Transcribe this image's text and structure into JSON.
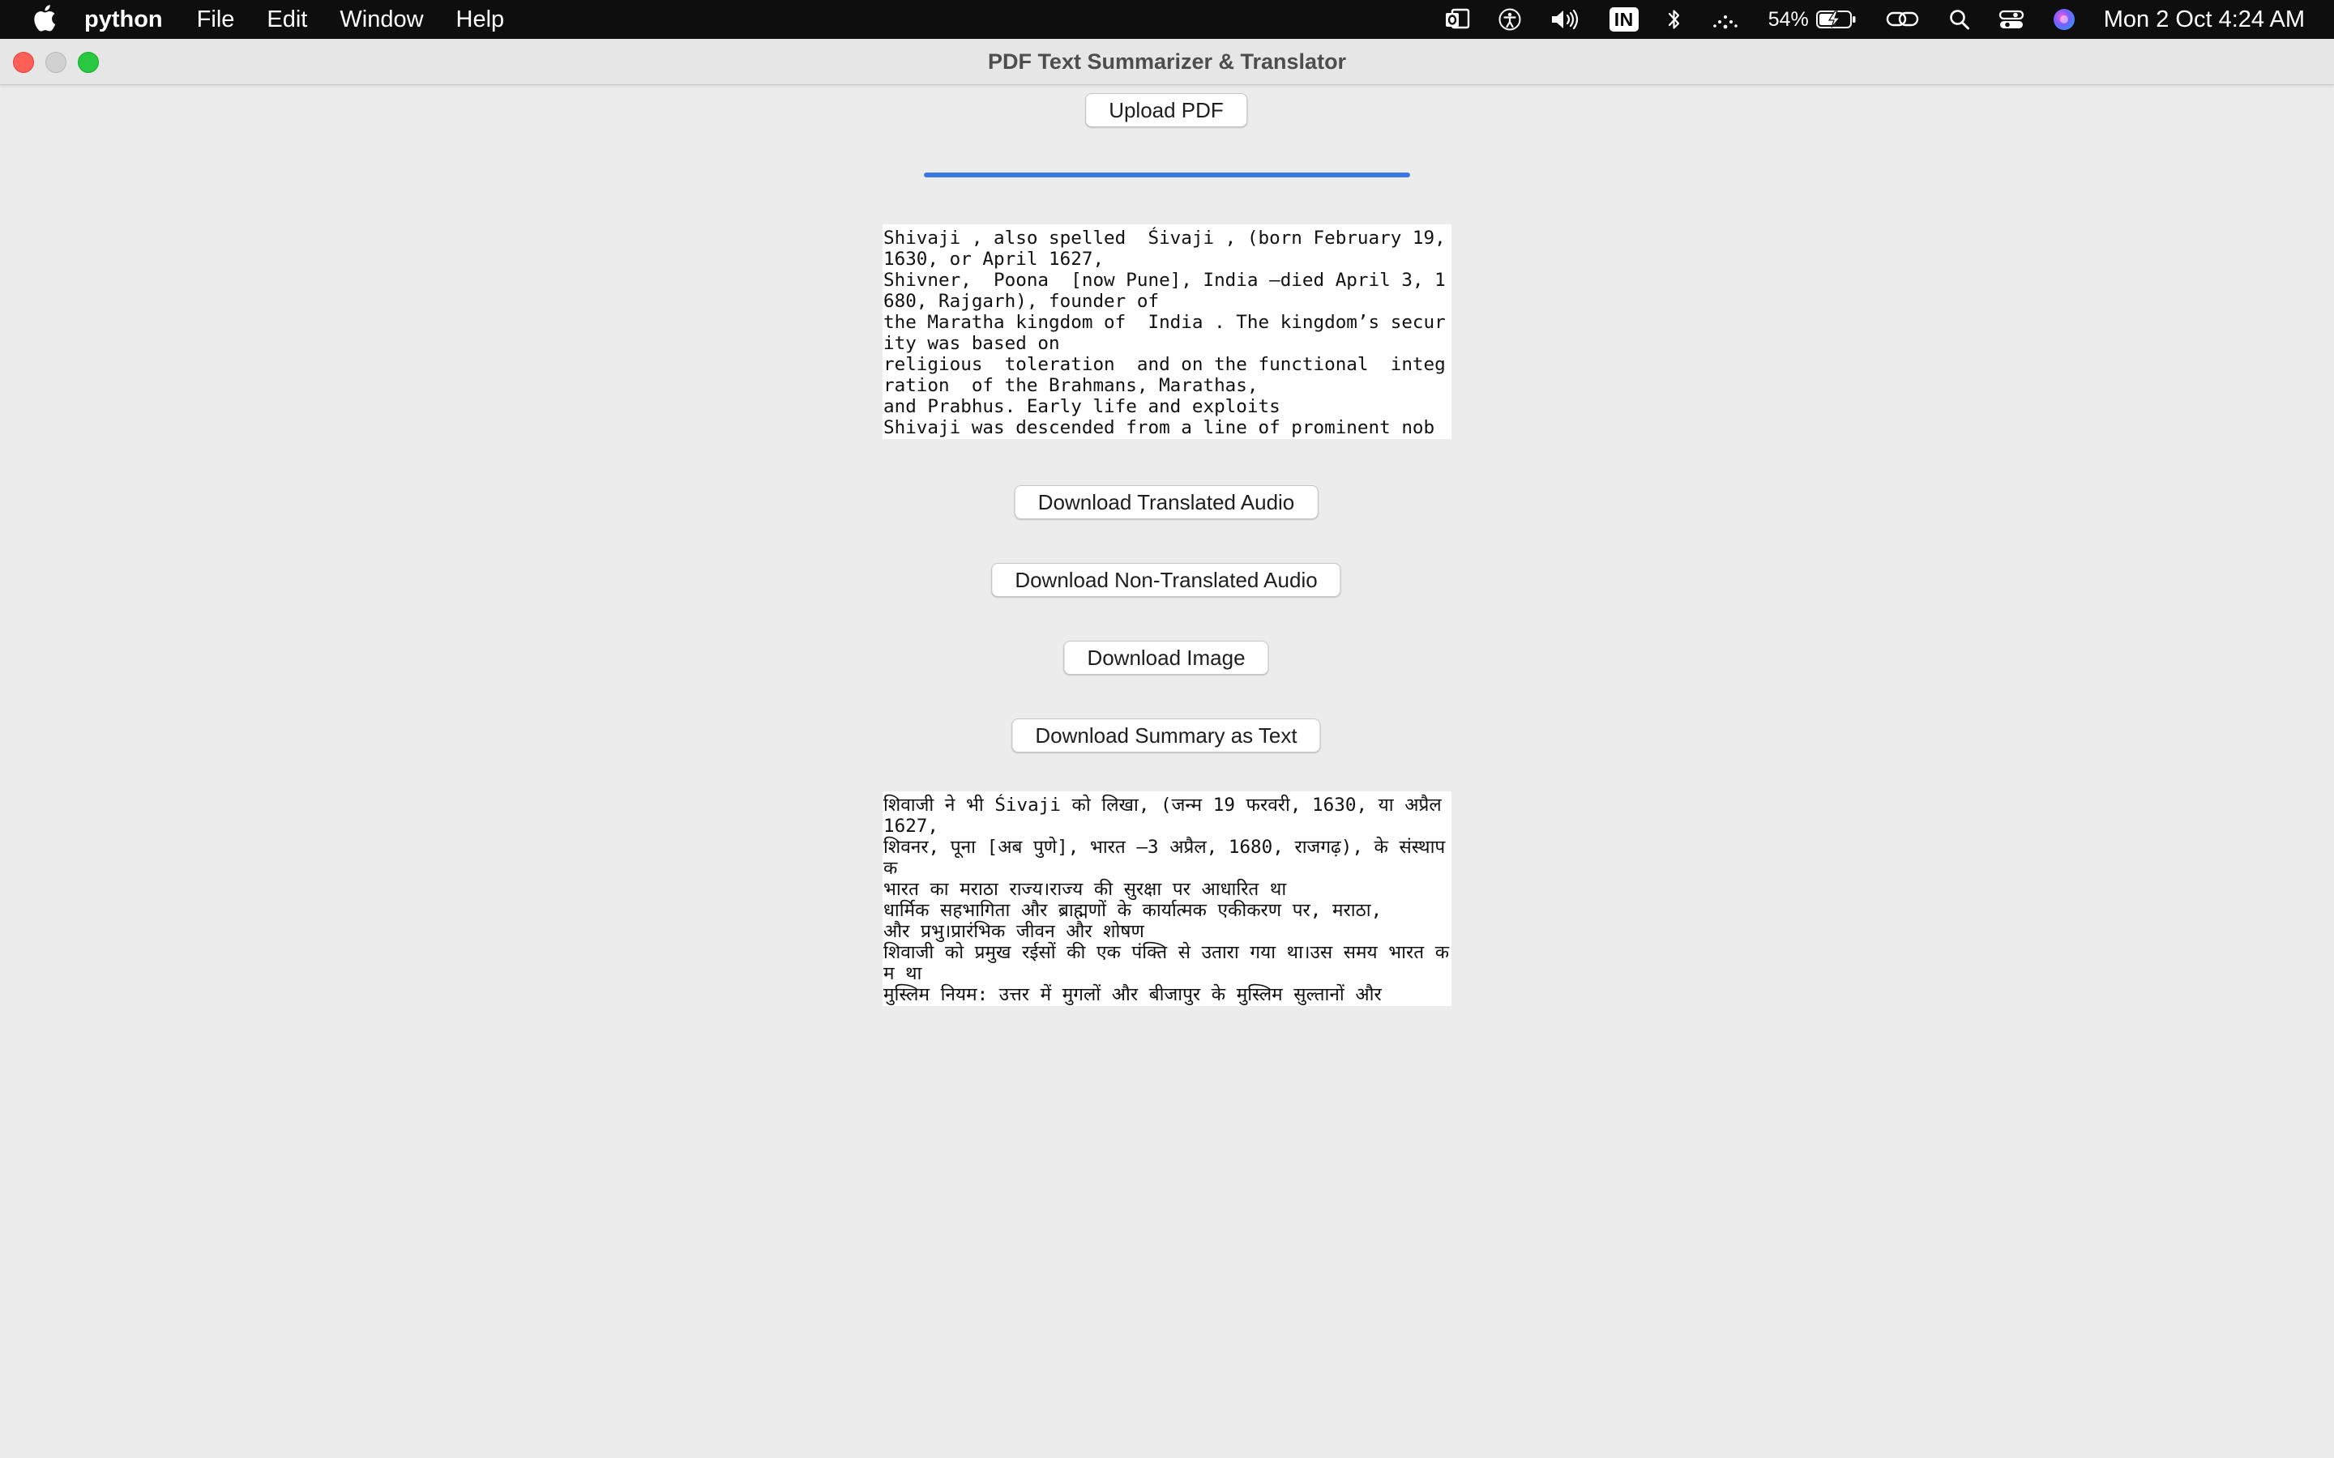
{
  "menubar": {
    "apple_icon": "apple-logo-icon",
    "app_name": "python",
    "menus": [
      "File",
      "Edit",
      "Window",
      "Help"
    ],
    "status": {
      "input_source": "IN",
      "battery_percent": "54%",
      "datetime": "Mon 2 Oct  4:24 AM"
    }
  },
  "window": {
    "title": "PDF Text Summarizer & Translator"
  },
  "upload_button_label": "Upload PDF",
  "progress_value": 1.0,
  "accent_color": "#3b79e0",
  "original_text": "Shivaji , also spelled  Śivaji , (born February 19, 1630, or April 1627,\nShivner,  Poona  [now Pune], India —died April 3, 1680, Rajgarh), founder of\nthe Maratha kingdom of  India . The kingdom’s security was based on\nreligious  toleration  and on the functional  integration  of the Brahmans, Marathas,\nand Prabhus. Early life and exploits\nShivaji was descended from a line of prominent nob",
  "buttons": {
    "translated_audio": "Download Translated Audio",
    "non_translated_audio": "Download Non-Translated Audio",
    "image": "Download Image",
    "summary_text": "Download Summary as Text"
  },
  "translated_text": "शिवाजी ने भी Śivaji को लिखा, (जन्म 19 फरवरी, 1630, या अप्रैल 1627,\nशिवनर, पूना [अब पुणे], भारत —3 अप्रैल, 1680, राजगढ़), के संस्थापक\nभारत का मराठा राज्य।राज्य की सुरक्षा पर आधारित था\nधार्मिक सहभागिता और ब्राह्मणों के कार्यात्मक एकीकरण पर, मराठा,\nऔर प्रभु।प्रारंभिक जीवन और शोषण\nशिवाजी को प्रमुख रईसों की एक पंक्ति से उतारा गया था।उस समय भारत कम था\nमुस्लिम नियम: उत्तर में मुगलों और बीजापुर के मुस्लिम सुल्तानों और"
}
